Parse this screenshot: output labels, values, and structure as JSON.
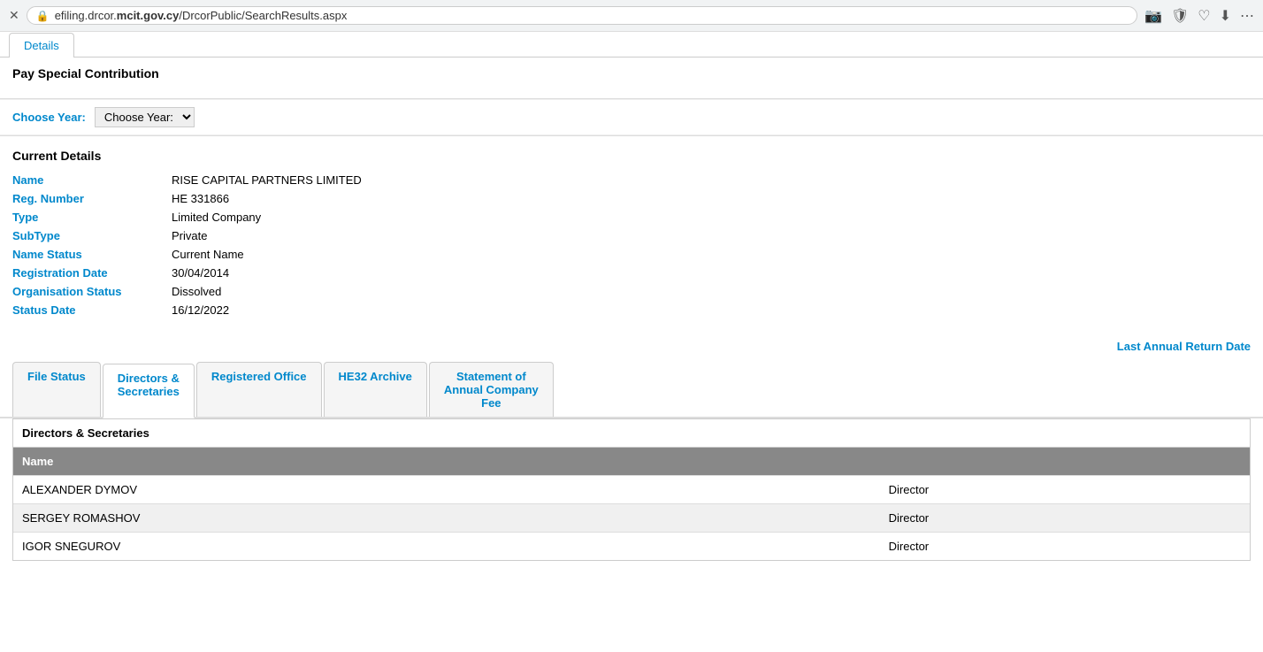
{
  "browser": {
    "url": "efiling.drcor.mcit.gov.cy/DrcorPublic/SearchResults.aspx",
    "url_plain": "efiling.drcor.",
    "url_domain": "mcit.gov.cy",
    "url_path": "/DrcorPublic/SearchResults.aspx"
  },
  "top_tab": {
    "label": "Details"
  },
  "pay_special": {
    "title": "Pay Special Contribution"
  },
  "choose_year": {
    "label": "Choose Year:",
    "select_default": "Choose Year:"
  },
  "current_details": {
    "title": "Current Details",
    "fields": [
      {
        "label": "Name",
        "value": "RISE CAPITAL PARTNERS LIMITED"
      },
      {
        "label": "Reg. Number",
        "value": "HE 331866"
      },
      {
        "label": "Type",
        "value": "Limited Company"
      },
      {
        "label": "SubType",
        "value": "Private"
      },
      {
        "label": "Name Status",
        "value": "Current Name"
      },
      {
        "label": "Registration Date",
        "value": "30/04/2014"
      },
      {
        "label": "Organisation Status",
        "value": "Dissolved"
      },
      {
        "label": "Status Date",
        "value": "16/12/2022"
      }
    ]
  },
  "last_annual_return": {
    "label": "Last Annual Return Date"
  },
  "tabs": [
    {
      "label": "File Status",
      "active": false
    },
    {
      "label": "Directors &\nSecretaries",
      "active": true
    },
    {
      "label": "Registered Office",
      "active": false
    },
    {
      "label": "HE32 Archive",
      "active": false
    },
    {
      "label": "Statement of\nAnnual Company\nFee",
      "active": false
    }
  ],
  "directors": {
    "section_title": "Directors & Secretaries",
    "table_header": "Name",
    "rows": [
      {
        "name": "ALEXANDER DYMOV",
        "role": "Director"
      },
      {
        "name": "SERGEY ROMASHOV",
        "role": "Director"
      },
      {
        "name": "IGOR SNEGUROV",
        "role": "Director"
      }
    ]
  }
}
